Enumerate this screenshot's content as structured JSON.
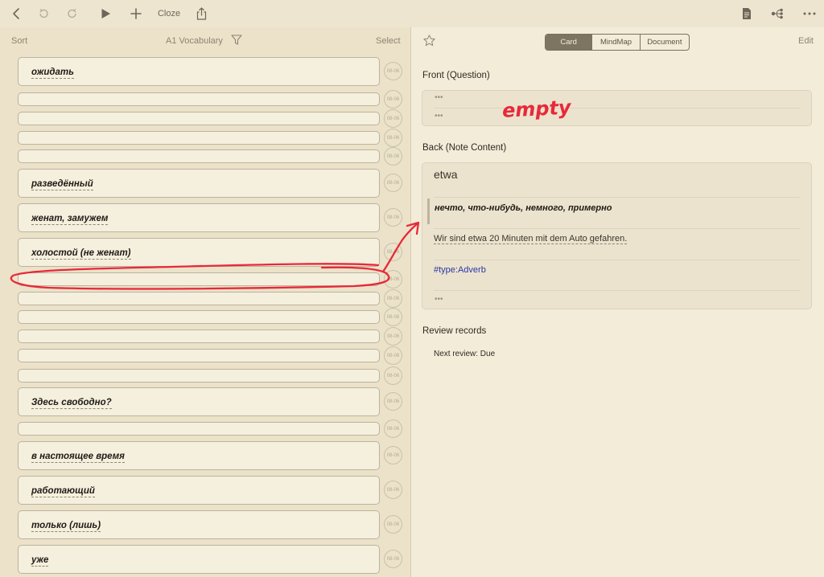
{
  "toolbar": {
    "cloze_label": "Cloze"
  },
  "list": {
    "sort_label": "Sort",
    "title": "A1 Vocabulary",
    "select_label": "Select",
    "date_badge": "08-06",
    "cards": [
      "ожидать",
      "",
      "",
      "",
      "",
      "разведённый",
      "женат, замужем",
      "холостой (не женат)",
      "",
      "",
      "",
      "",
      "",
      "",
      "Здесь свободно?",
      "",
      "в настоящее время",
      "работающий",
      "только (лишь)",
      "уже"
    ]
  },
  "detail": {
    "segments": [
      "Card",
      "MindMap",
      "Document"
    ],
    "active_segment": "Card",
    "edit_label": "Edit",
    "front_label": "Front (Question)",
    "back_label": "Back (Note Content)",
    "back_word": "etwa",
    "back_meaning": "нечто, что-нибудь, немного, примерно",
    "back_example": "Wir sind etwa 20 Minuten mit dem Auto gefahren.",
    "back_tag": "#type:Adverb",
    "review_label": "Review records",
    "next_review": "Next review: Due"
  },
  "annotation": {
    "handwritten_text": "empty",
    "color": "#e8293a"
  },
  "colors": {
    "background": "#f3ecd9",
    "list_background": "#ebe2c9",
    "accent": "#7d7462",
    "tag": "#2b36a8"
  }
}
